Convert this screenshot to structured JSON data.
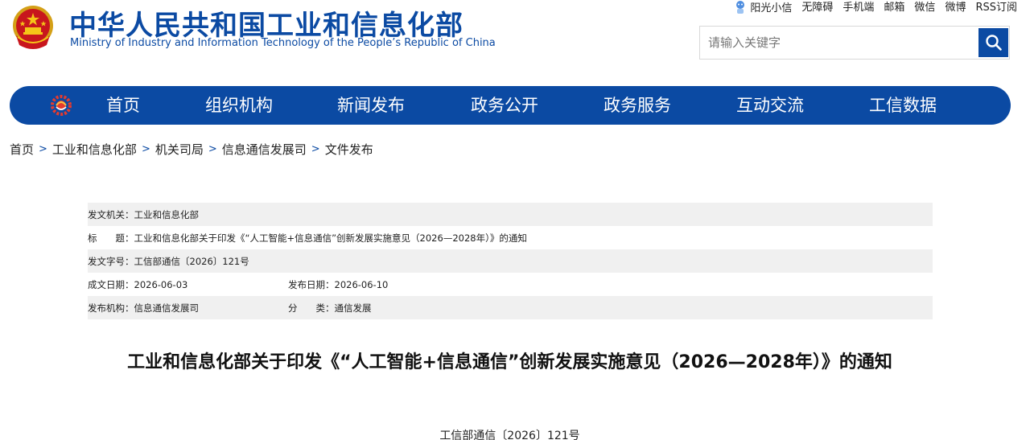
{
  "header": {
    "title_cn": "中华人民共和国工业和信息化部",
    "title_en": "Ministry of Industry and Information Technology of the People’s Republic of China",
    "top_links": [
      "阳光小信",
      "无障碍",
      "手机端",
      "邮箱",
      "微信",
      "微博",
      "RSS订阅"
    ],
    "search_placeholder": "请输入关键字"
  },
  "nav": {
    "items": [
      "首页",
      "组织机构",
      "新闻发布",
      "政务公开",
      "政务服务",
      "互动交流",
      "工信数据"
    ]
  },
  "breadcrumb": [
    "首页",
    "工业和信息化部",
    "机关司局",
    "信息通信发展司",
    "文件发布"
  ],
  "meta": {
    "issuer_label": "发文机关：",
    "issuer": "工业和信息化部",
    "title_label": "标　　题：",
    "title": "工业和信息化部关于印发《“人工智能+信息通信”创新发展实施意见（2026—2028年）》的通知",
    "doc_no_label": "发文字号：",
    "doc_no": "工信部通信〔2026〕121号",
    "created_label": "成文日期：",
    "created": "2026-06-03",
    "published_label": "发布日期：",
    "published": "2026-06-10",
    "org_label": "发布机构：",
    "org": "信息通信发展司",
    "category_label": "分　　类：",
    "category": "通信发展"
  },
  "document": {
    "heading": "工业和信息化部关于印发《“人工智能+信息通信”创新发展实施意见（2026—2028年）》的通知",
    "number": "工信部通信〔2026〕121号"
  },
  "colors": {
    "brand_blue": "#0b4aa3",
    "row_shade": "#f0f0f0"
  }
}
